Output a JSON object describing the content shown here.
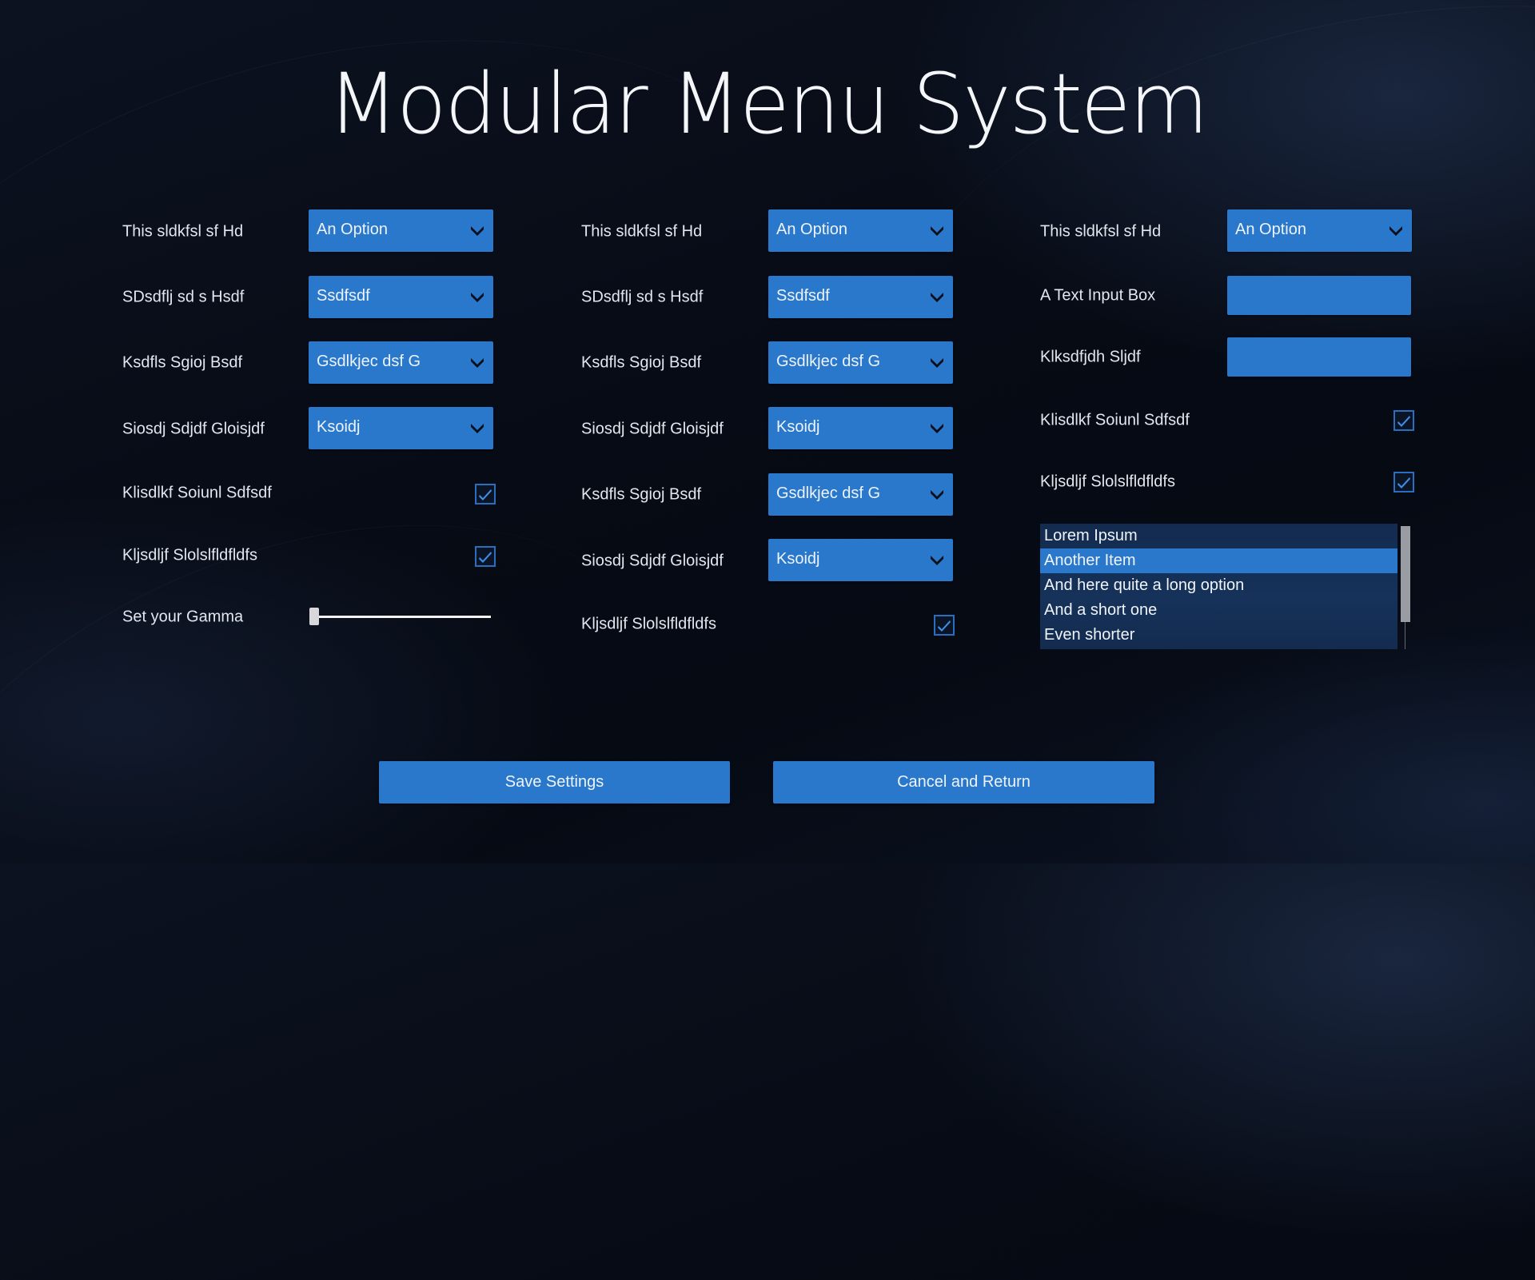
{
  "title": "Modular Menu System",
  "colors": {
    "accent": "#2a78cc",
    "background": "#070b15",
    "list_background": "#15305a",
    "text": "#e2e6ee"
  },
  "column1": {
    "rows": [
      {
        "type": "dropdown",
        "label": "This sldkfsl sf Hd",
        "value": "An Option"
      },
      {
        "type": "dropdown",
        "label": "SDsdflj sd s Hsdf",
        "value": "Ssdfsdf"
      },
      {
        "type": "dropdown",
        "label": "Ksdfls Sgioj Bsdf",
        "value": "Gsdlkjec dsf G"
      },
      {
        "type": "dropdown",
        "label": "Siosdj Sdjdf Gloisjdf",
        "value": "Ksoidj"
      },
      {
        "type": "checkbox",
        "label": "Klisdlkf Soiunl Sdfsdf",
        "checked": true
      },
      {
        "type": "checkbox",
        "label": "Kljsdljf Slolslfldfldfs",
        "checked": true
      },
      {
        "type": "slider",
        "label": "Set your Gamma",
        "value_fraction": 0.0
      }
    ]
  },
  "column2": {
    "rows": [
      {
        "type": "dropdown",
        "label": "This sldkfsl sf Hd",
        "value": "An Option"
      },
      {
        "type": "dropdown",
        "label": "SDsdflj sd s Hsdf",
        "value": "Ssdfsdf"
      },
      {
        "type": "dropdown",
        "label": "Ksdfls Sgioj Bsdf",
        "value": "Gsdlkjec dsf G"
      },
      {
        "type": "dropdown",
        "label": "Siosdj Sdjdf Gloisjdf",
        "value": "Ksoidj"
      },
      {
        "type": "dropdown",
        "label": "Ksdfls Sgioj Bsdf",
        "value": "Gsdlkjec dsf G"
      },
      {
        "type": "dropdown",
        "label": "Siosdj Sdjdf Gloisjdf",
        "value": "Ksoidj"
      },
      {
        "type": "checkbox",
        "label": "Kljsdljf Slolslfldfldfs",
        "checked": true
      }
    ]
  },
  "column3": {
    "rows": [
      {
        "type": "dropdown",
        "label": "This sldkfsl sf Hd",
        "value": "An Option"
      },
      {
        "type": "text",
        "label": "A Text Input Box",
        "value": "",
        "placeholder": ""
      },
      {
        "type": "text",
        "label": "Klksdfjdh Sljdf",
        "value": "",
        "placeholder": ""
      },
      {
        "type": "checkbox",
        "label": "Klisdlkf Soiunl Sdfsdf",
        "checked": true
      },
      {
        "type": "checkbox",
        "label": "Kljsdljf Slolslfldfldfs",
        "checked": true
      }
    ],
    "list": {
      "items": [
        "Lorem Ipsum",
        "Another Item",
        "And here quite a long option",
        "And a short one",
        "Even shorter"
      ],
      "selected_index": 1
    }
  },
  "buttons": {
    "save": "Save Settings",
    "cancel": "Cancel and Return"
  },
  "icons": {
    "dropdown": "chevron-down-icon",
    "checkbox": "checkmark-icon"
  }
}
